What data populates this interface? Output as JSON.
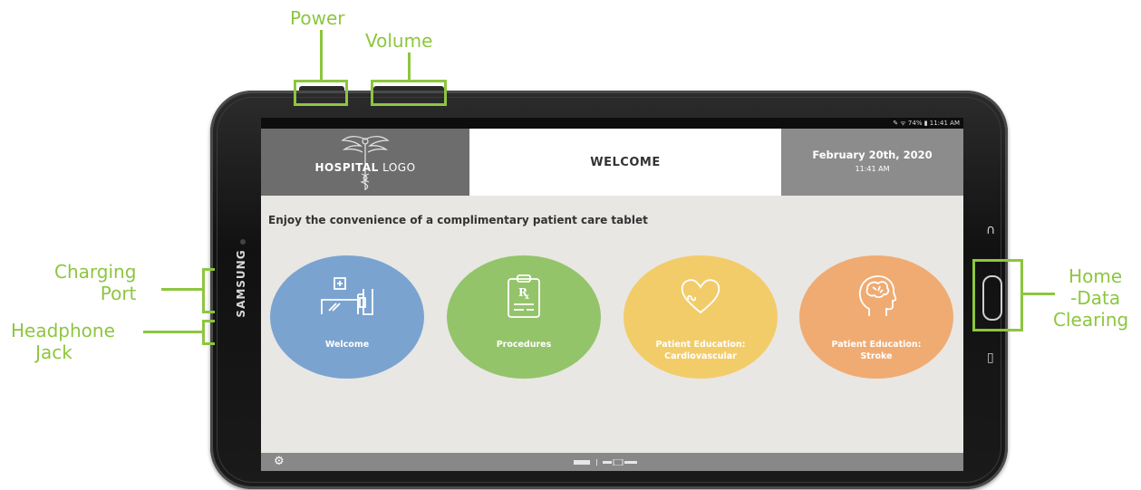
{
  "callouts": {
    "power": "Power",
    "volume": "Volume",
    "charging_port": [
      "Charging",
      "Port"
    ],
    "headphone_jack": [
      "Headphone",
      "Jack"
    ],
    "home": [
      "Home",
      "-Data",
      "Clearing"
    ]
  },
  "device": {
    "brand": "SAMSUNG",
    "status_bar": "✎ ᯤ 74% ▮ 11:41 AM"
  },
  "header": {
    "logo_text_bold": "HOSPITAL",
    "logo_text_light": " LOGO",
    "title": "WELCOME",
    "date": "February 20th, 2020",
    "time": "11:41 AM"
  },
  "main": {
    "tagline": "Enjoy the convenience of a complimentary patient care tablet",
    "tiles": [
      {
        "label": "Welcome",
        "icon": "hospital-bed-icon",
        "color": "#7ba3d0"
      },
      {
        "label": "Procedures",
        "icon": "prescription-clipboard-icon",
        "color": "#94c46a"
      },
      {
        "label": "Patient Education: Cardiovascular",
        "icon": "heart-icon",
        "color": "#f3cc6a"
      },
      {
        "label": "Patient Education: Stroke",
        "icon": "brain-head-icon",
        "color": "#f0ab72"
      }
    ]
  },
  "footer": {
    "settings_icon": "gear-icon"
  }
}
